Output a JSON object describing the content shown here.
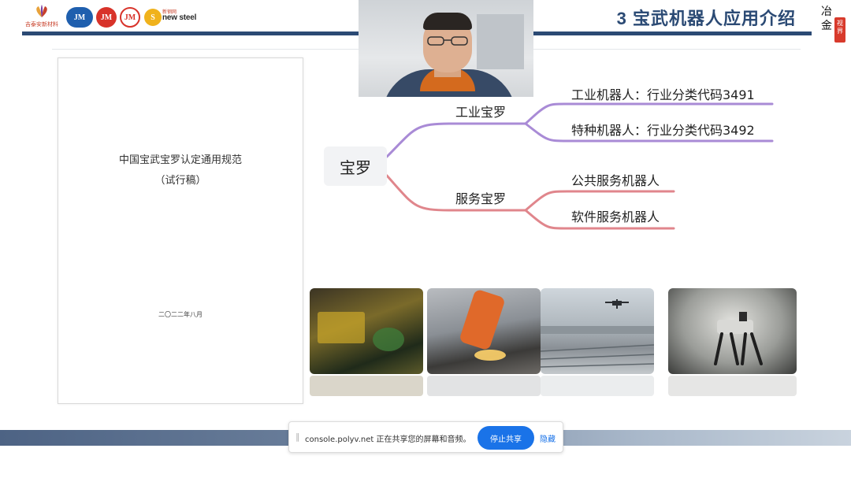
{
  "header": {
    "title": "3 宝武机器人应用介绍",
    "logos": {
      "logo1_text": "吉泰安新材料",
      "logo5_label": "新钢网",
      "logo5_text": "new steel"
    },
    "brand_mark": {
      "char1": "冶",
      "char2": "金",
      "seal": "视界"
    }
  },
  "document": {
    "title": "中国宝武宝罗认定通用规范",
    "subtitle": "（试行稿）",
    "date": "二〇二二年八月"
  },
  "mindmap": {
    "root": "宝罗",
    "branches": [
      {
        "label": "工业宝罗",
        "color": "#a98bd6",
        "leaves": [
          "工业机器人：行业分类代码3491",
          "特种机器人：行业分类代码3492"
        ]
      },
      {
        "label": "服务宝罗",
        "color": "#e0868c",
        "leaves": [
          "公共服务机器人",
          "软件服务机器人"
        ]
      }
    ]
  },
  "photos": [
    "industrial-line-photo",
    "welding-robot-arm-photo",
    "inspection-drone-photo",
    "quadruped-robot-photo"
  ],
  "share_bar": {
    "message": "console.polyv.net 正在共享您的屏幕和音频。",
    "stop_button": "停止共享",
    "hide_link": "隐藏"
  },
  "colors": {
    "header_rule": "#2b4a74",
    "accent_blue": "#1a73e8"
  }
}
